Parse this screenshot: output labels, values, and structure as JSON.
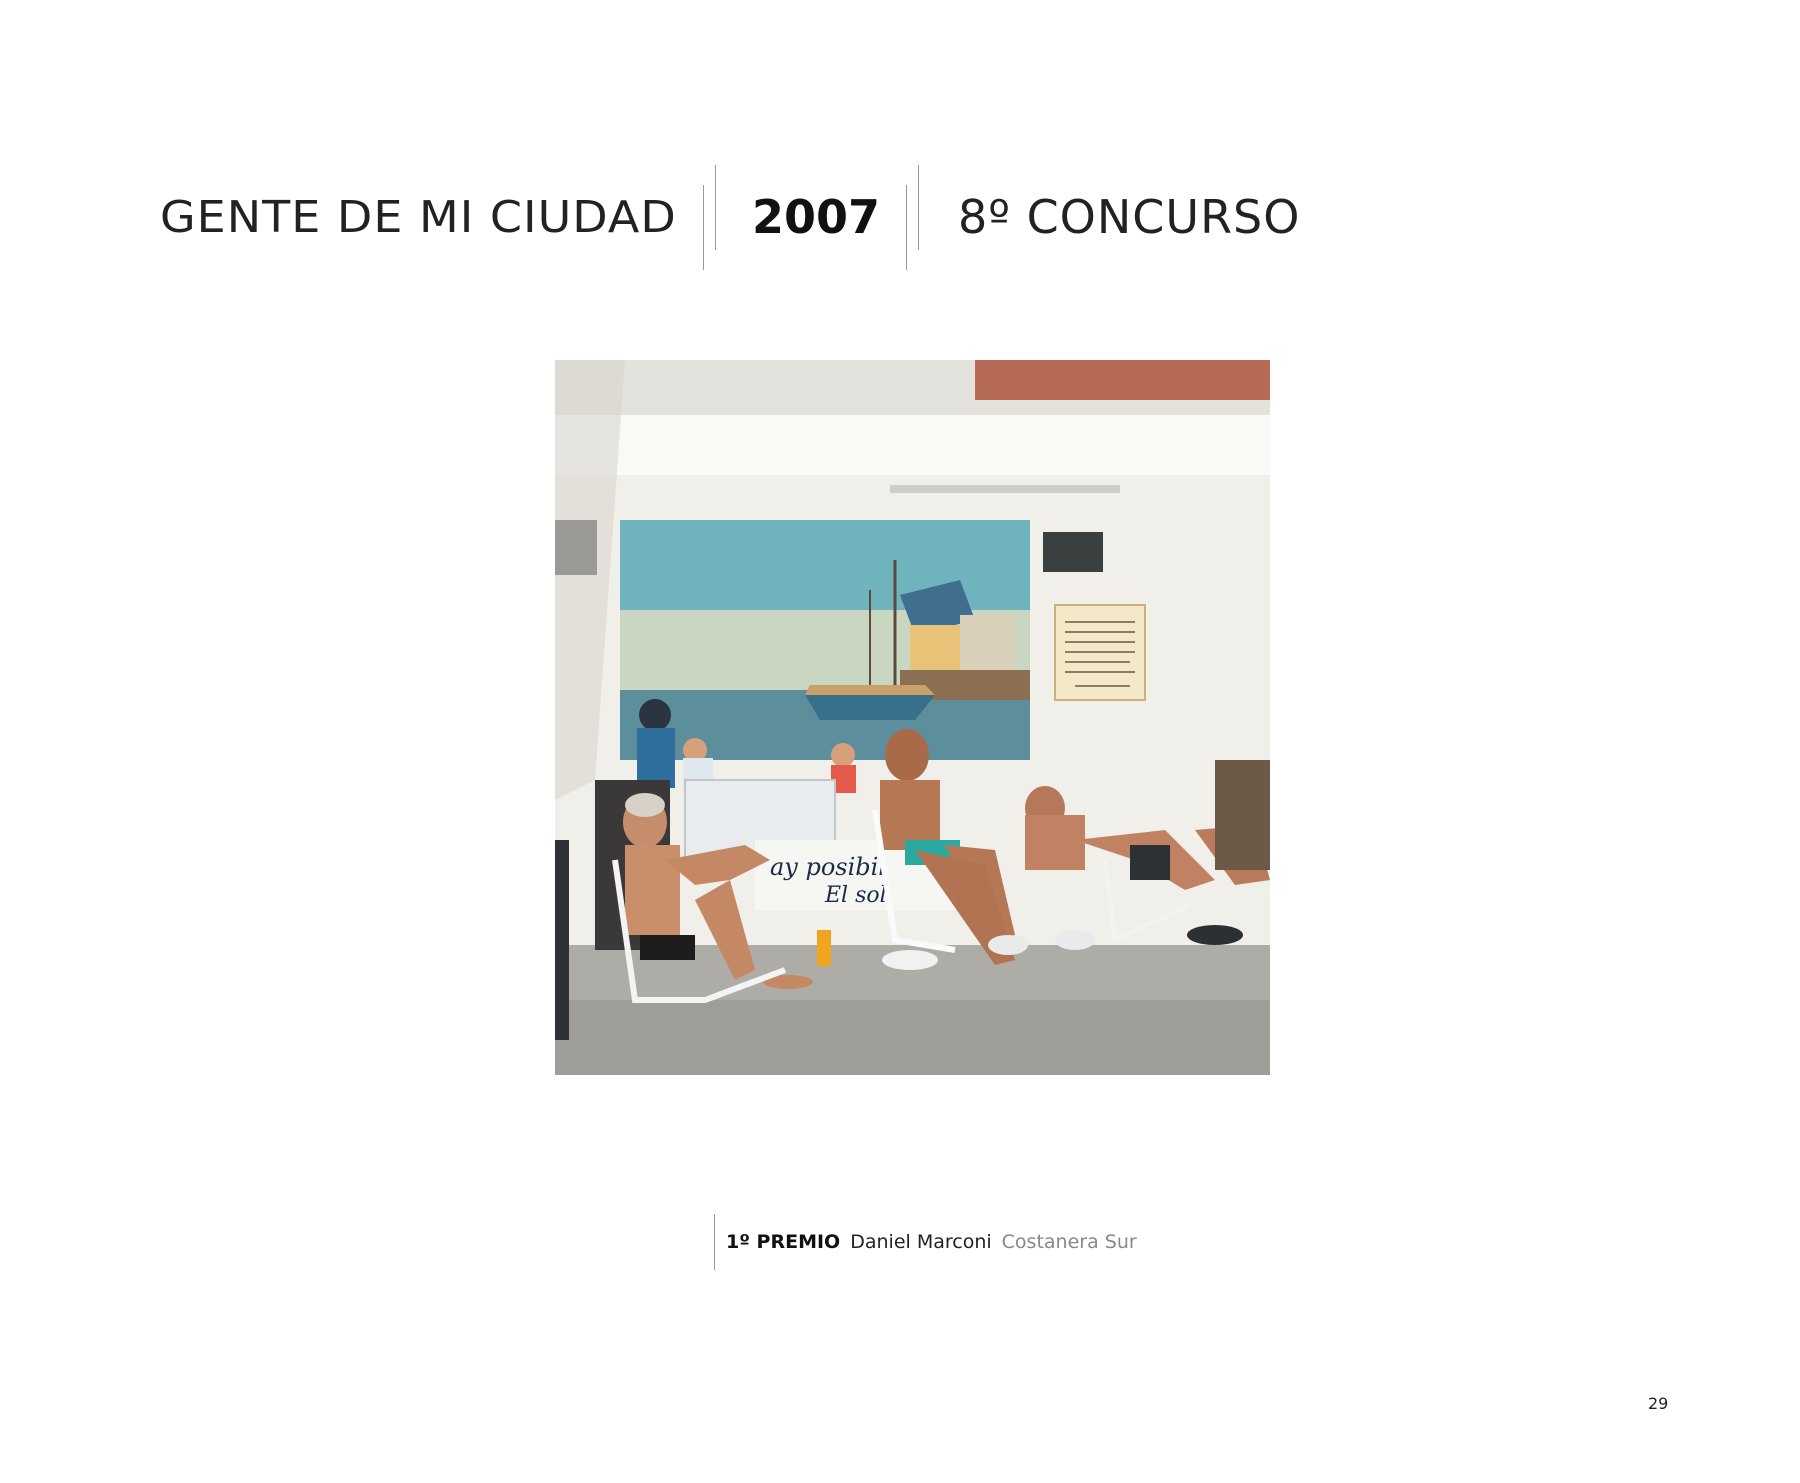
{
  "header": {
    "title": "GENTE DE MI CIUDAD",
    "year": "2007",
    "edition": "8º CONCURSO"
  },
  "photo": {
    "mural_text_line1": "ay posibil",
    "mural_text_line2": "El sol"
  },
  "caption": {
    "prize": "1º PREMIO",
    "author": "Daniel Marconi",
    "place": "Costanera Sur"
  },
  "page_number": "29",
  "colors": {
    "text_dark": "#111111",
    "text_muted": "#888888",
    "divider": "#999999"
  }
}
